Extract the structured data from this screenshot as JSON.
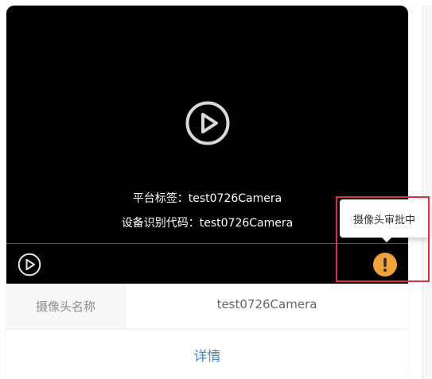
{
  "camera_card": {
    "overlay": {
      "platform_tag_line": "平台标签：test0726Camera",
      "device_code_line": "设备识别代码：test0726Camera"
    },
    "info": {
      "name_label": "摄像头名称",
      "name_value": "test0726Camera"
    },
    "details_label": "详情"
  },
  "status_tooltip": {
    "text": "摄像头审批中"
  },
  "icons": {
    "center_play": "play-circle-icon",
    "control_play": "play-circle-icon",
    "status": "exclamation-icon"
  },
  "colors": {
    "video_bg": "#000000",
    "warning": "#f0a23b",
    "link": "#3f86d8",
    "highlight": "#e0323d"
  }
}
